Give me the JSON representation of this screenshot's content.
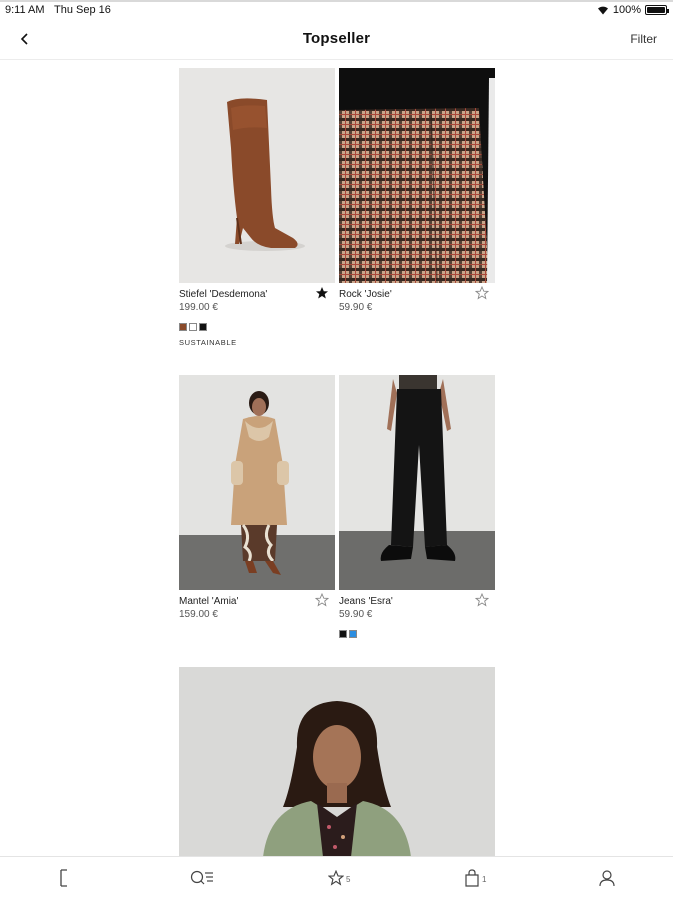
{
  "status": {
    "time": "9:11 AM",
    "date": "Thu Sep 16",
    "battery": "100%"
  },
  "header": {
    "title": "Topseller",
    "filter_label": "Filter",
    "back_icon": "chevron-left-icon"
  },
  "products": [
    {
      "name": "Stiefel 'Desdemona'",
      "price": "199.00 €",
      "favorited": true,
      "swatch_colors": [
        "#8a4a2a",
        "#ffffff",
        "#111111"
      ],
      "tag": "SUSTAINABLE"
    },
    {
      "name": "Rock 'Josie'",
      "price": "59.90 €",
      "favorited": false
    },
    {
      "name": "Mantel 'Amia'",
      "price": "159.00 €",
      "favorited": false
    },
    {
      "name": "Jeans 'Esra'",
      "price": "59.90 €",
      "favorited": false,
      "swatch_colors": [
        "#111111",
        "#2b8de0"
      ]
    }
  ],
  "bottom_nav": {
    "items": [
      {
        "icon": "brand-logo-icon",
        "label": ""
      },
      {
        "icon": "search-categories-icon",
        "label": ""
      },
      {
        "icon": "star-icon",
        "count": "5"
      },
      {
        "icon": "shopping-bag-icon",
        "count": "1"
      },
      {
        "icon": "user-icon",
        "label": ""
      }
    ]
  }
}
